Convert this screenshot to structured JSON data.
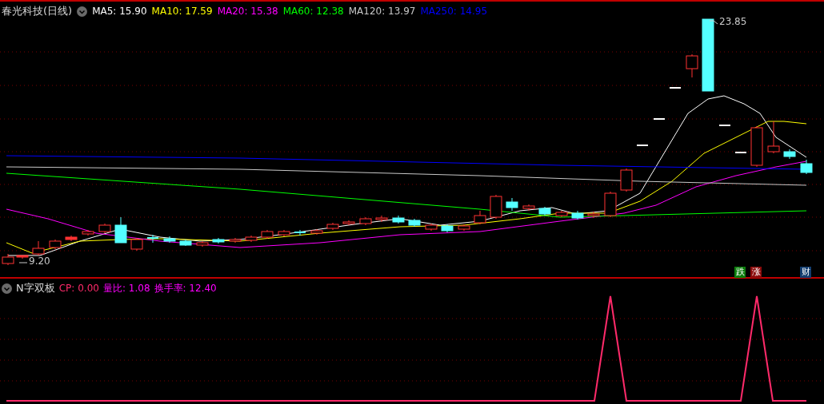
{
  "main_panel": {
    "title": "春光科技(日线)",
    "legend": [
      {
        "label": "MA5: 15.90",
        "color": "#ffffff"
      },
      {
        "label": "MA10: 17.59",
        "color": "#ffff00"
      },
      {
        "label": "MA20: 15.38",
        "color": "#ff00ff"
      },
      {
        "label": "MA60: 12.38",
        "color": "#00ff00"
      },
      {
        "label": "MA120: 13.97",
        "color": "#c8c8c8"
      },
      {
        "label": "MA250: 14.95",
        "color": "#0000ff"
      }
    ],
    "high_label": "23.85",
    "low_label": "9.20",
    "badges": [
      {
        "label": "跌",
        "color": "#0b7d0b"
      },
      {
        "label": "涨",
        "color": "#8a0a0a"
      },
      {
        "label": "财",
        "color": "#123c6e"
      }
    ]
  },
  "indicator_panel": {
    "title": "N字双板",
    "items": [
      {
        "label": "CP: 0.00",
        "color": "#ff2a6a"
      },
      {
        "label": "量比: 1.08",
        "color": "#ff00ff"
      },
      {
        "label": "换手率: 12.40",
        "color": "#ff00ff"
      }
    ]
  }
}
